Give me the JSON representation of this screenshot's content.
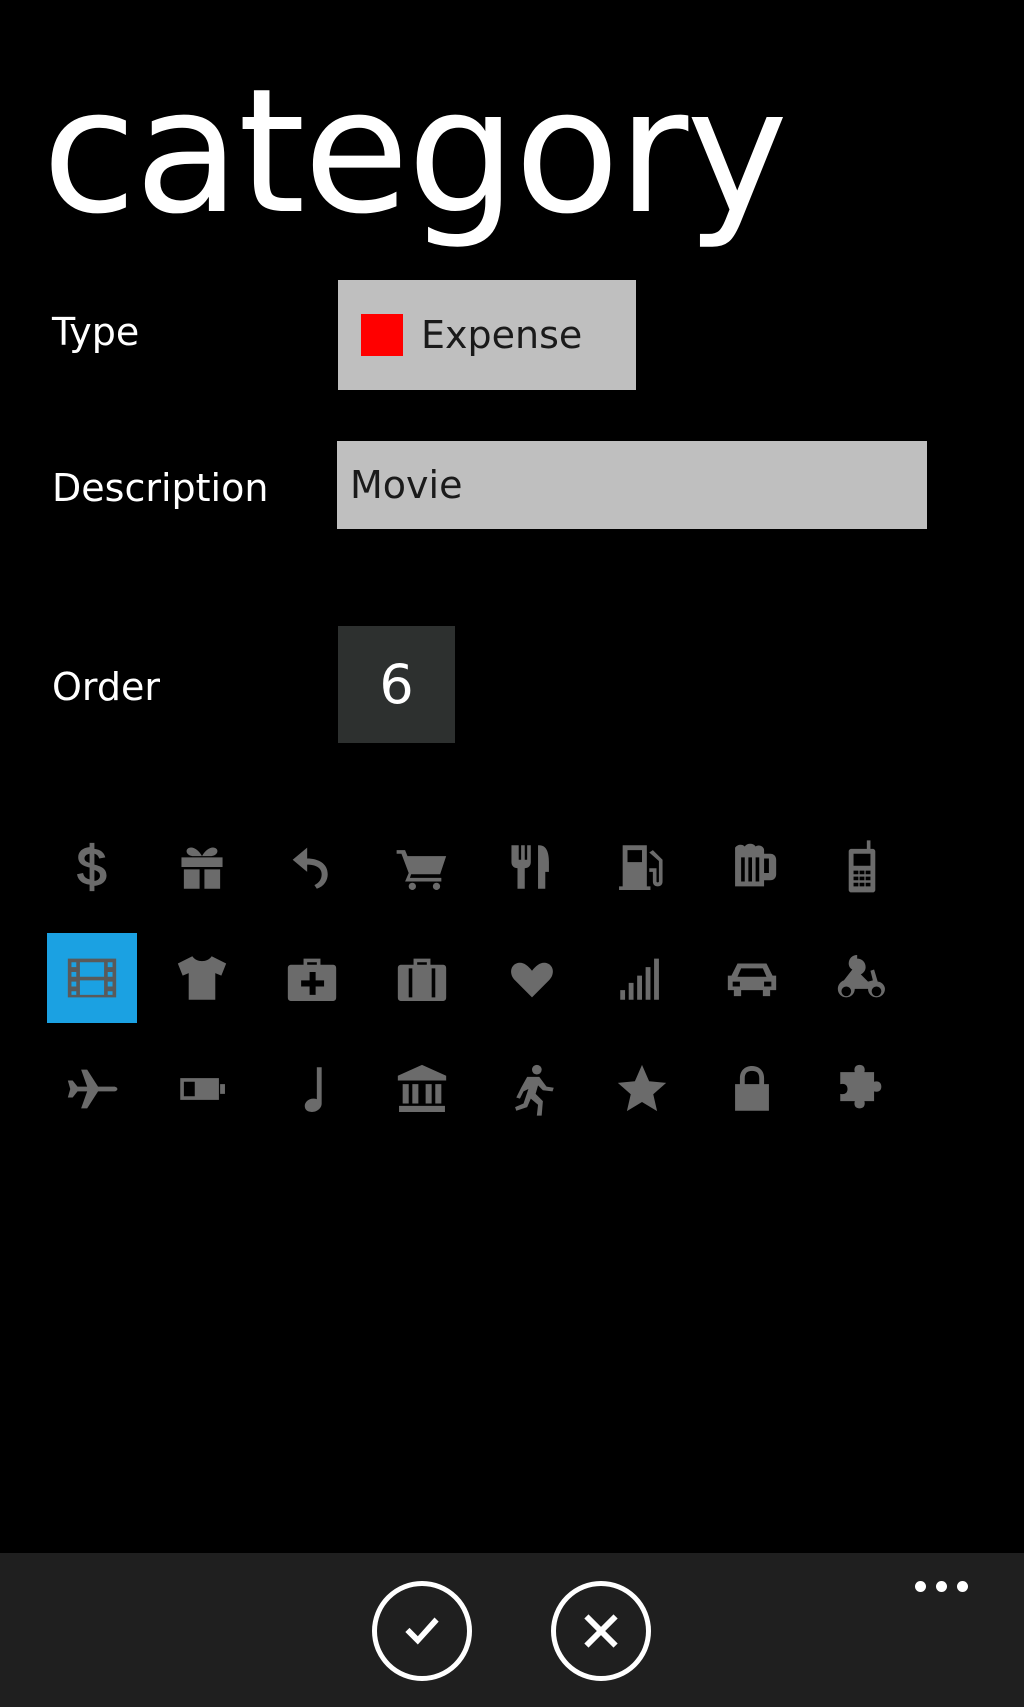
{
  "page": {
    "title": "category"
  },
  "form": {
    "type": {
      "label": "Type",
      "value": "Expense",
      "swatch_color": "#ff0000"
    },
    "description": {
      "label": "Description",
      "value": "Movie"
    },
    "order": {
      "label": "Order",
      "value": "6"
    }
  },
  "icons": {
    "selected": "film-icon",
    "items": [
      "dollar-icon",
      "gift-icon",
      "undo-icon",
      "cart-icon",
      "fork-knife-icon",
      "fuel-pump-icon",
      "beer-mug-icon",
      "mobile-phone-icon",
      "film-icon",
      "tshirt-icon",
      "medical-kit-icon",
      "briefcase-icon",
      "heart-icon",
      "signal-bars-icon",
      "car-icon",
      "scooter-icon",
      "airplane-icon",
      "battery-icon",
      "music-note-icon",
      "bank-icon",
      "runner-icon",
      "star-icon",
      "lock-icon",
      "puzzle-icon"
    ]
  },
  "app_bar": {
    "buttons": [
      "check-icon",
      "close-icon"
    ],
    "more": "more-options-icon"
  },
  "colors": {
    "background": "#000000",
    "field_bg": "#bfbfbf",
    "order_bg": "#2d302f",
    "accent": "#1ba1e2",
    "icon": "#6b6b6b",
    "app_bar": "#1f1f1f"
  }
}
